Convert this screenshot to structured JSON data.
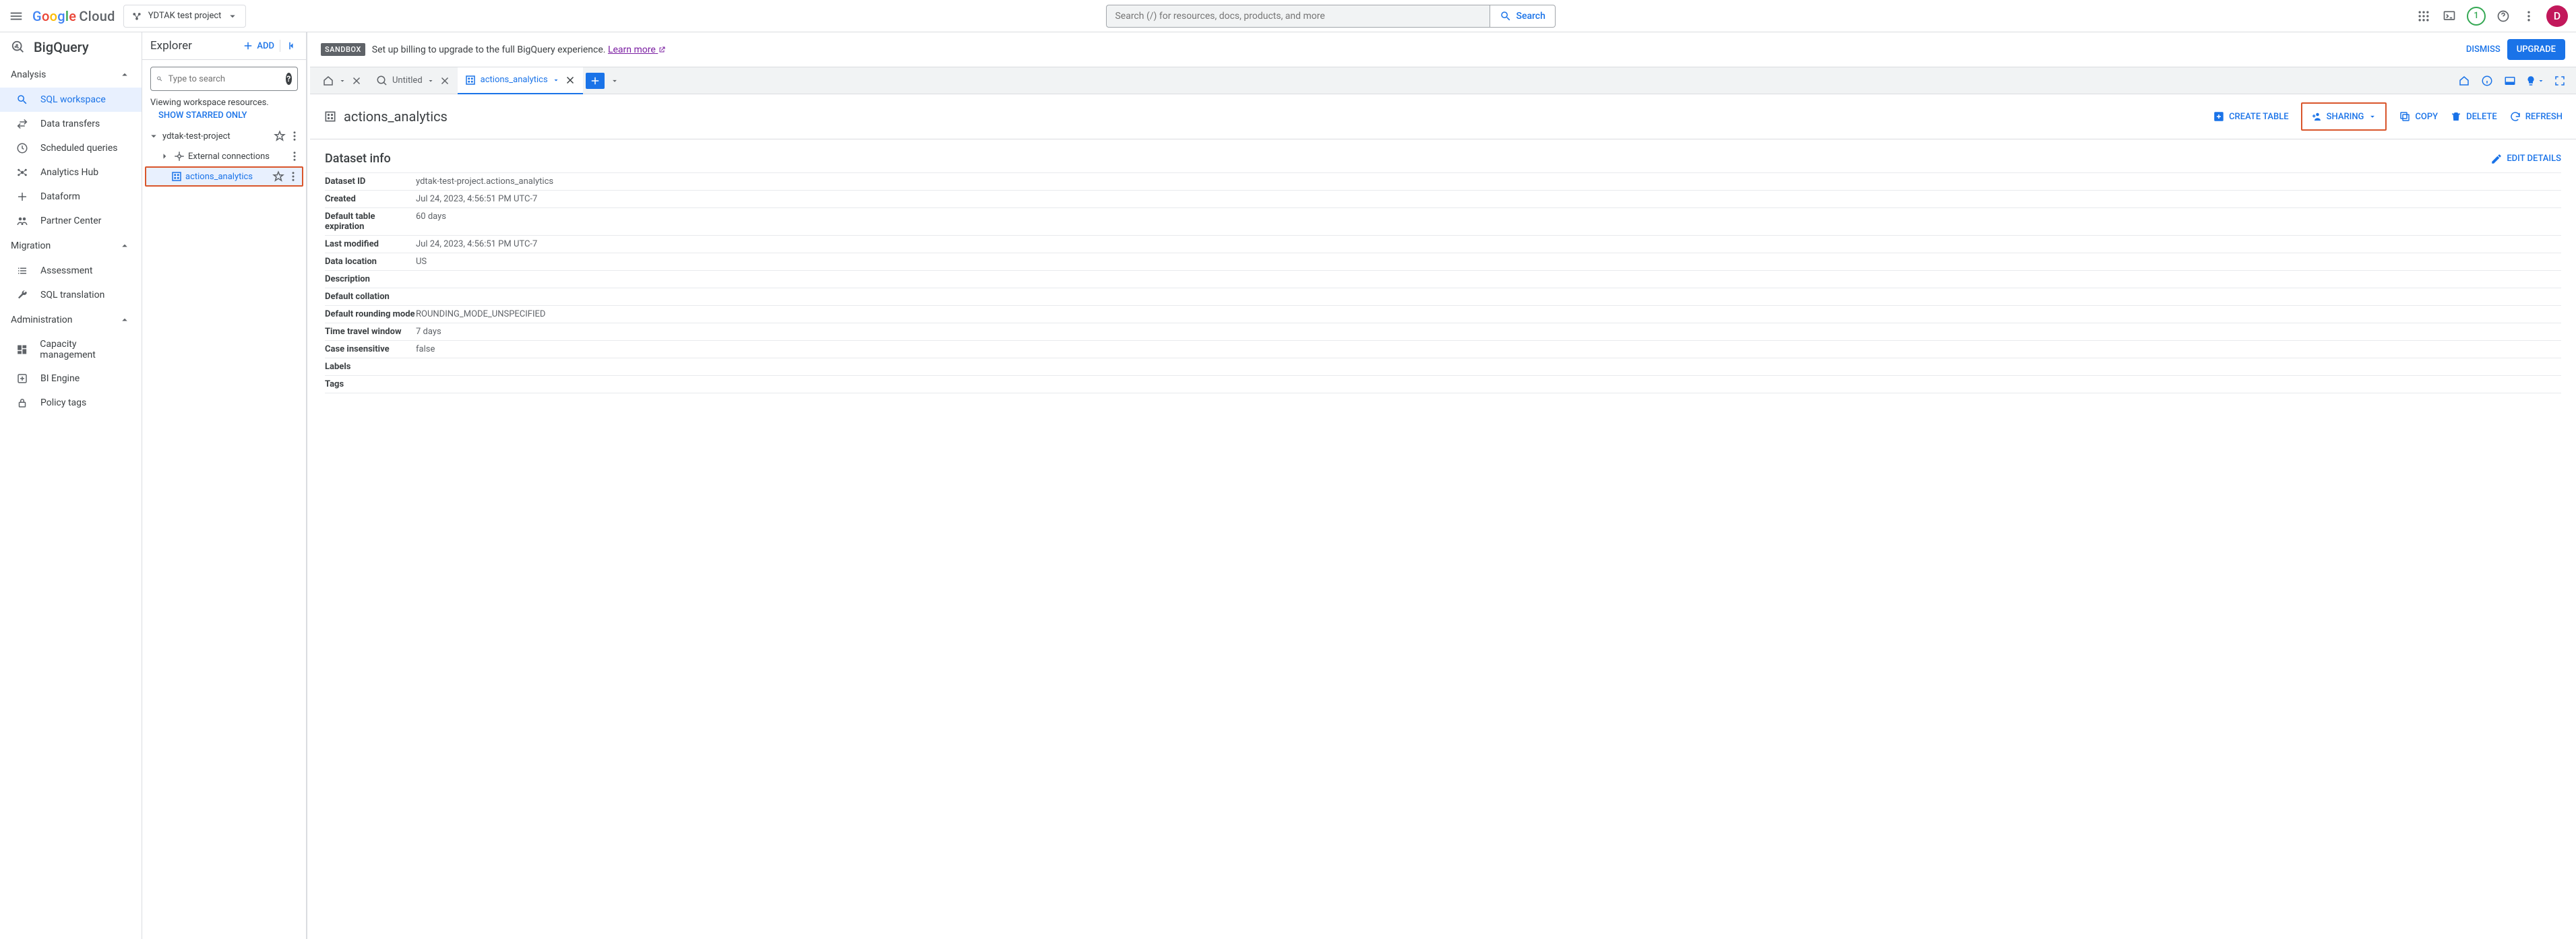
{
  "brand": {
    "name": "Google",
    "product": "Cloud"
  },
  "project_picker": {
    "label": "YDTAK test project"
  },
  "search": {
    "placeholder": "Search (/) for resources, docs, products, and more",
    "button": "Search"
  },
  "topbar": {
    "badge": "1",
    "avatar_initial": "D"
  },
  "product_title": "BigQuery",
  "nav": {
    "sections": [
      {
        "title": "Analysis",
        "items": [
          {
            "id": "sql",
            "label": "SQL workspace",
            "icon": "search"
          },
          {
            "id": "dt",
            "label": "Data transfers",
            "icon": "swap"
          },
          {
            "id": "sq",
            "label": "Scheduled queries",
            "icon": "clock"
          },
          {
            "id": "ah",
            "label": "Analytics Hub",
            "icon": "hub"
          },
          {
            "id": "df",
            "label": "Dataform",
            "icon": "dataform"
          },
          {
            "id": "pc",
            "label": "Partner Center",
            "icon": "partner"
          }
        ]
      },
      {
        "title": "Migration",
        "items": [
          {
            "id": "asm",
            "label": "Assessment",
            "icon": "list"
          },
          {
            "id": "st",
            "label": "SQL translation",
            "icon": "wrench"
          }
        ]
      },
      {
        "title": "Administration",
        "items": [
          {
            "id": "cm",
            "label": "Capacity management",
            "icon": "dashboard"
          },
          {
            "id": "bi",
            "label": "BI Engine",
            "icon": "engine"
          },
          {
            "id": "pt",
            "label": "Policy tags",
            "icon": "lock"
          }
        ]
      }
    ]
  },
  "explorer": {
    "title": "Explorer",
    "add": "ADD",
    "search_placeholder": "Type to search",
    "viewing": "Viewing workspace resources.",
    "show_starred": "SHOW STARRED ONLY",
    "tree": {
      "project": "ydtak-test-project",
      "external": "External connections",
      "dataset": "actions_analytics"
    }
  },
  "sandbox": {
    "tag": "SANDBOX",
    "message": "Set up billing to upgrade to the full BigQuery experience.",
    "learn": "Learn more",
    "dismiss": "DISMISS",
    "upgrade": "UPGRADE"
  },
  "tabs": {
    "untitled": "Untitled",
    "dataset": "actions_analytics"
  },
  "content": {
    "title": "actions_analytics",
    "actions": {
      "create_table": "CREATE TABLE",
      "sharing": "SHARING",
      "copy": "COPY",
      "delete": "DELETE",
      "refresh": "REFRESH"
    },
    "info_title": "Dataset info",
    "edit_details": "EDIT DETAILS",
    "rows": [
      {
        "label": "Dataset ID",
        "value": "ydtak-test-project.actions_analytics"
      },
      {
        "label": "Created",
        "value": "Jul 24, 2023, 4:56:51 PM UTC-7"
      },
      {
        "label": "Default table expiration",
        "value": "60 days"
      },
      {
        "label": "Last modified",
        "value": "Jul 24, 2023, 4:56:51 PM UTC-7"
      },
      {
        "label": "Data location",
        "value": "US"
      },
      {
        "label": "Description",
        "value": ""
      },
      {
        "label": "Default collation",
        "value": ""
      },
      {
        "label": "Default rounding mode",
        "value": "ROUNDING_MODE_UNSPECIFIED"
      },
      {
        "label": "Time travel window",
        "value": "7 days"
      },
      {
        "label": "Case insensitive",
        "value": "false"
      },
      {
        "label": "Labels",
        "value": ""
      },
      {
        "label": "Tags",
        "value": ""
      }
    ]
  }
}
